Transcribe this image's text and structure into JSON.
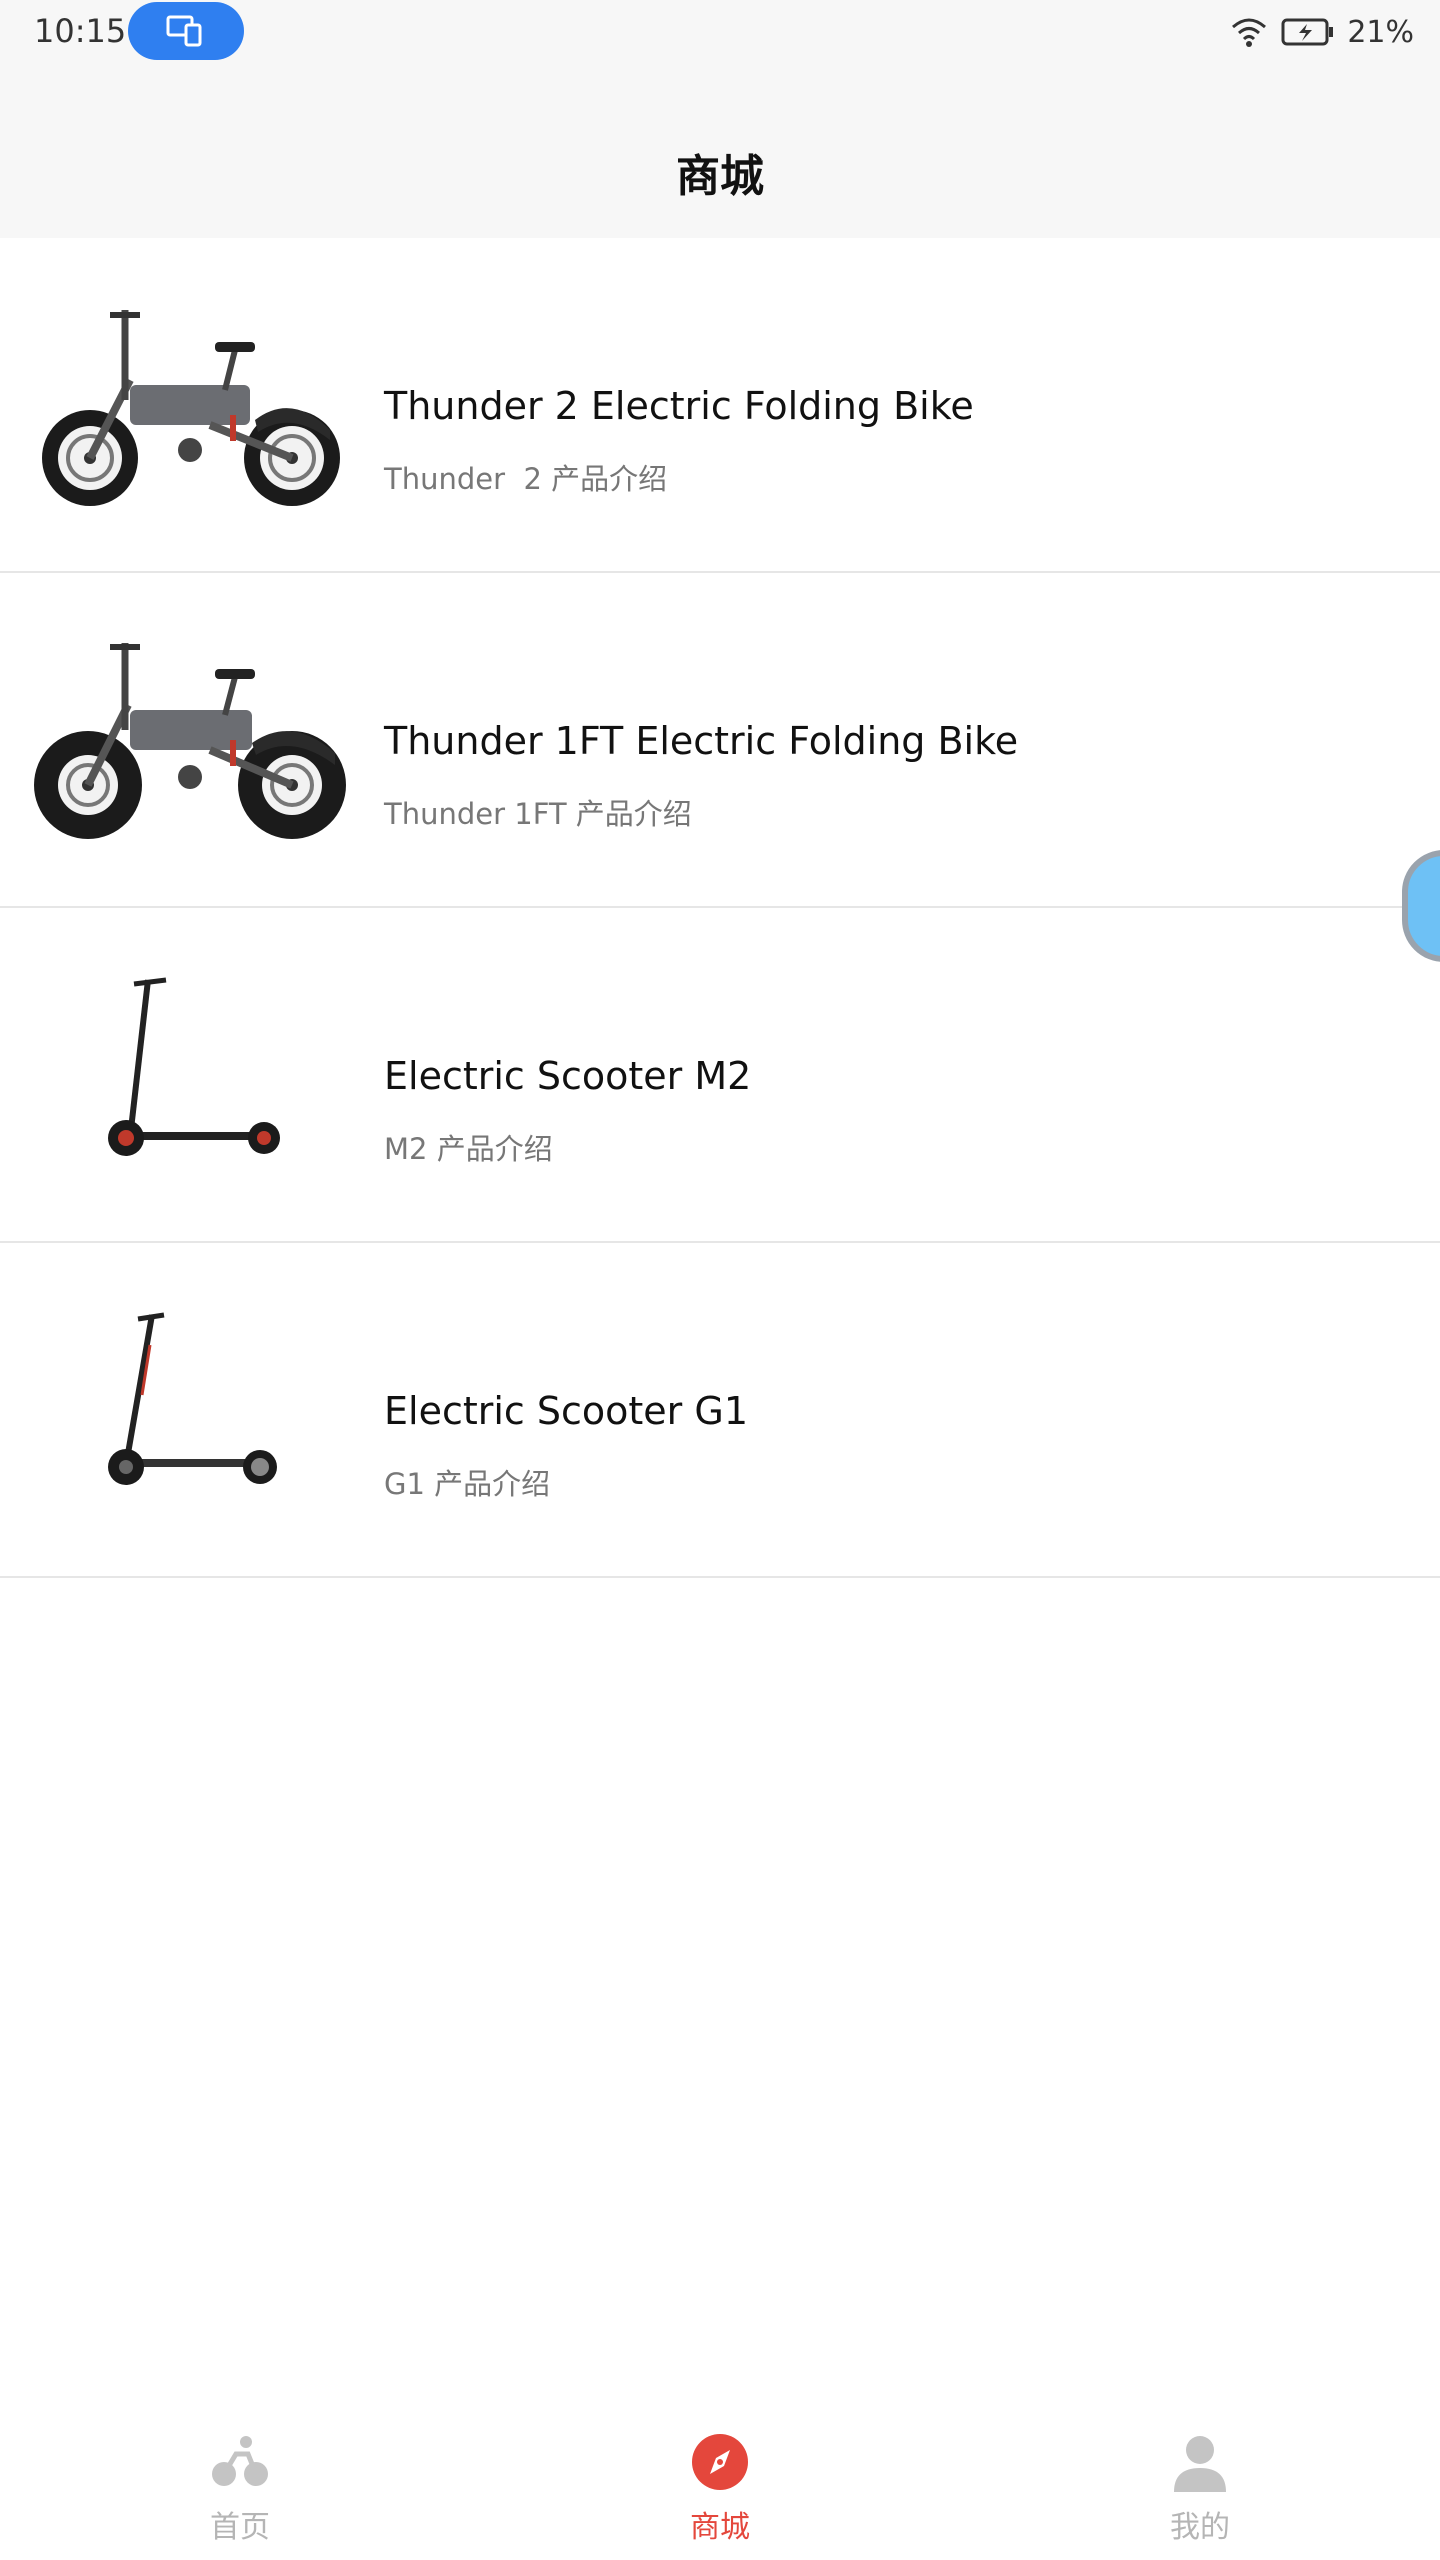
{
  "status_bar": {
    "time": "10:15",
    "battery": "21%",
    "icons": [
      "screen-share-icon",
      "wifi-icon",
      "battery-charging-icon"
    ]
  },
  "header": {
    "title": "商城"
  },
  "products": [
    {
      "name": "Thunder 2 Electric Folding Bike",
      "desc": "Thunder  2 产品介绍",
      "image": "folding-bike-image"
    },
    {
      "name": "Thunder 1FT Electric Folding Bike",
      "desc": "Thunder 1FT 产品介绍",
      "image": "fat-tire-bike-image"
    },
    {
      "name": "Electric Scooter M2",
      "desc": "M2 产品介绍",
      "image": "scooter-m2-image"
    },
    {
      "name": "Electric Scooter G1",
      "desc": "G1 产品介绍",
      "image": "scooter-g1-image"
    }
  ],
  "tabbar": {
    "tabs": [
      {
        "label": "首页",
        "icon": "bike-icon",
        "active": false
      },
      {
        "label": "商城",
        "icon": "compass-icon",
        "active": true
      },
      {
        "label": "我的",
        "icon": "person-icon",
        "active": false
      }
    ]
  },
  "colors": {
    "accent": "#e4473c",
    "pill": "#2f7ff0",
    "inactive_tab": "#b5b5b5"
  }
}
